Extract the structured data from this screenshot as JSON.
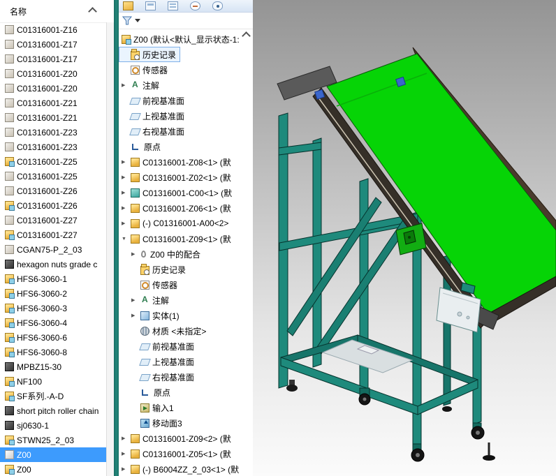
{
  "colors": {
    "belt_green": "#06d406",
    "frame_teal": "#1e8a7c",
    "selection_blue": "#3d9bfd",
    "splitter_teal": "#23857a"
  },
  "left_panel": {
    "header": "名称",
    "collapse_icon": "chevron-up",
    "items": [
      {
        "label": "C01316001-Z16",
        "icon": "part-gray"
      },
      {
        "label": "C01316001-Z17",
        "icon": "part-gray"
      },
      {
        "label": "C01316001-Z17",
        "icon": "part-gray"
      },
      {
        "label": "C01316001-Z20",
        "icon": "part-gray"
      },
      {
        "label": "C01316001-Z20",
        "icon": "part-gray"
      },
      {
        "label": "C01316001-Z21",
        "icon": "part-gray"
      },
      {
        "label": "C01316001-Z21",
        "icon": "part-gray"
      },
      {
        "label": "C01316001-Z23",
        "icon": "part-gray"
      },
      {
        "label": "C01316001-Z23",
        "icon": "part-gray"
      },
      {
        "label": "C01316001-Z25",
        "icon": "asm-gold"
      },
      {
        "label": "C01316001-Z25",
        "icon": "part-gray"
      },
      {
        "label": "C01316001-Z26",
        "icon": "part-gray"
      },
      {
        "label": "C01316001-Z26",
        "icon": "asm-gold"
      },
      {
        "label": "C01316001-Z27",
        "icon": "part-gray"
      },
      {
        "label": "C01316001-Z27",
        "icon": "asm-gold"
      },
      {
        "label": "CGAN75-P_2_03",
        "icon": "part-gray"
      },
      {
        "label": "hexagon nuts grade c",
        "icon": "part-dark"
      },
      {
        "label": "HFS6-3060-1",
        "icon": "asm-gold"
      },
      {
        "label": "HFS6-3060-2",
        "icon": "asm-gold"
      },
      {
        "label": "HFS6-3060-3",
        "icon": "asm-gold"
      },
      {
        "label": "HFS6-3060-4",
        "icon": "asm-gold"
      },
      {
        "label": "HFS6-3060-6",
        "icon": "asm-gold"
      },
      {
        "label": "HFS6-3060-8",
        "icon": "asm-gold"
      },
      {
        "label": "MPBZ15-30",
        "icon": "part-dark"
      },
      {
        "label": "NF100",
        "icon": "asm-gold"
      },
      {
        "label": "SF系列.-A-D",
        "icon": "asm-gold"
      },
      {
        "label": "short pitch roller chain",
        "icon": "part-dark"
      },
      {
        "label": "sj0630-1",
        "icon": "part-dark"
      },
      {
        "label": "STWN25_2_03",
        "icon": "asm-gold"
      },
      {
        "label": "Z00",
        "icon": "part-light",
        "selected": true
      },
      {
        "label": "Z00",
        "icon": "asm-gold"
      }
    ]
  },
  "toolbar": {
    "icons": [
      "featuremanager",
      "propertymanager",
      "configurationmanager",
      "dimxpertmanager",
      "displaymanager"
    ]
  },
  "filter": {
    "icon": "filter-funnel"
  },
  "tree": {
    "scroll_up_icon": "chevron-up",
    "items": [
      {
        "label": "Z00 (默认<默认_显示状态-1:",
        "icon": "asm",
        "depth": 0,
        "expander": "none"
      },
      {
        "label": "历史记录",
        "icon": "history",
        "depth": 1,
        "boxed": true
      },
      {
        "label": "传感器",
        "icon": "sensor",
        "depth": 1
      },
      {
        "label": "注解",
        "icon": "annotations",
        "depth": 1,
        "expander": "collapsed"
      },
      {
        "label": "前视基准面",
        "icon": "plane",
        "depth": 1
      },
      {
        "label": "上视基准面",
        "icon": "plane",
        "depth": 1
      },
      {
        "label": "右视基准面",
        "icon": "plane",
        "depth": 1
      },
      {
        "label": "原点",
        "icon": "origin",
        "depth": 1
      },
      {
        "label": "C01316001-Z08<1> (默",
        "icon": "part-gold",
        "depth": 1,
        "expander": "collapsed"
      },
      {
        "label": "C01316001-Z02<1> (默",
        "icon": "part-gold",
        "depth": 1,
        "expander": "collapsed"
      },
      {
        "label": "C01316001-C00<1> (默",
        "icon": "part-teal",
        "depth": 1,
        "expander": "collapsed"
      },
      {
        "label": "C01316001-Z06<1> (默",
        "icon": "part-gold",
        "depth": 1,
        "expander": "collapsed"
      },
      {
        "label": "(-) C01316001-A00<2>",
        "icon": "part-gold",
        "depth": 1,
        "expander": "collapsed"
      },
      {
        "label": "C01316001-Z09<1> (默",
        "icon": "part-gold",
        "depth": 1,
        "expander": "expanded"
      },
      {
        "label": "Z00 中的配合",
        "icon": "mates",
        "depth": 2,
        "expander": "collapsed"
      },
      {
        "label": "历史记录",
        "icon": "history",
        "depth": 2
      },
      {
        "label": "传感器",
        "icon": "sensor",
        "depth": 2
      },
      {
        "label": "注解",
        "icon": "annotations",
        "depth": 2,
        "expander": "collapsed"
      },
      {
        "label": "实体(1)",
        "icon": "bodies",
        "depth": 2,
        "expander": "collapsed"
      },
      {
        "label": "材质 <未指定>",
        "icon": "material",
        "depth": 2
      },
      {
        "label": "前视基准面",
        "icon": "plane",
        "depth": 2
      },
      {
        "label": "上视基准面",
        "icon": "plane",
        "depth": 2
      },
      {
        "label": "右视基准面",
        "icon": "plane",
        "depth": 2
      },
      {
        "label": "原点",
        "icon": "origin",
        "depth": 2
      },
      {
        "label": "输入1",
        "icon": "imported",
        "depth": 2
      },
      {
        "label": "移动面3",
        "icon": "moveface",
        "depth": 2
      },
      {
        "label": "C01316001-Z09<2> (默",
        "icon": "part-gold",
        "depth": 1,
        "expander": "collapsed"
      },
      {
        "label": "C01316001-Z05<1> (默",
        "icon": "part-gold",
        "depth": 1,
        "expander": "collapsed"
      },
      {
        "label": "(-) B6004ZZ_2_03<1> (默",
        "icon": "part-gold",
        "depth": 1,
        "expander": "collapsed"
      }
    ]
  }
}
